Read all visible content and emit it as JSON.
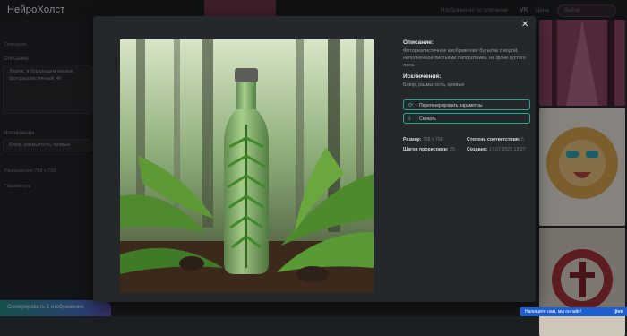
{
  "header": {
    "logo": "НейроХолст",
    "nav_images_by_description": "Изображения по описанию",
    "vk_label": "VK",
    "nav_right": "Цены",
    "login_label": "Войти"
  },
  "sidebar": {
    "tab_label": "Описание",
    "description_label": "Описание",
    "description_text": "Лампа, в бушующем океане, фотореалистичный, 4k",
    "exclusions_label": "Исключения",
    "exclusions_text": "Блюр, размытость, кривые",
    "resolution_label": "Разрешение 768 x 768",
    "parameters_label": "Параметры",
    "footer_note": "Осталось неограниченно 20 изображений",
    "generate_button": "Сгенерировать 1 изображение"
  },
  "modal": {
    "close_icon": "close-icon",
    "description_heading": "Описание:",
    "description_value": "Фотореалистичное изображение бутылки с водой, наполненной листьями папоротника, на фоне густого леса",
    "exclusions_heading": "Исключения:",
    "exclusions_value": "Блюр, размытость, кривые",
    "regenerate_button": "Перегенерировать параметры",
    "download_button": "Скачать",
    "size_label": "Размер:",
    "size_value": "768 x 768",
    "steps_label": "Шагов прорисовки:",
    "steps_value": "25",
    "similarity_label": "Степень соответствия:",
    "similarity_value": "6",
    "created_label": "Создано:",
    "created_value": "17.07.2023 13:27"
  },
  "chat_widget": {
    "text": "Напишите нам, мы онлайн!",
    "brand": "jivo"
  },
  "colors": {
    "accent": "#1fa896",
    "modal_bg": "#24282b",
    "page_bg": "#1c1f22",
    "chat_blue": "#1d5fd0"
  }
}
